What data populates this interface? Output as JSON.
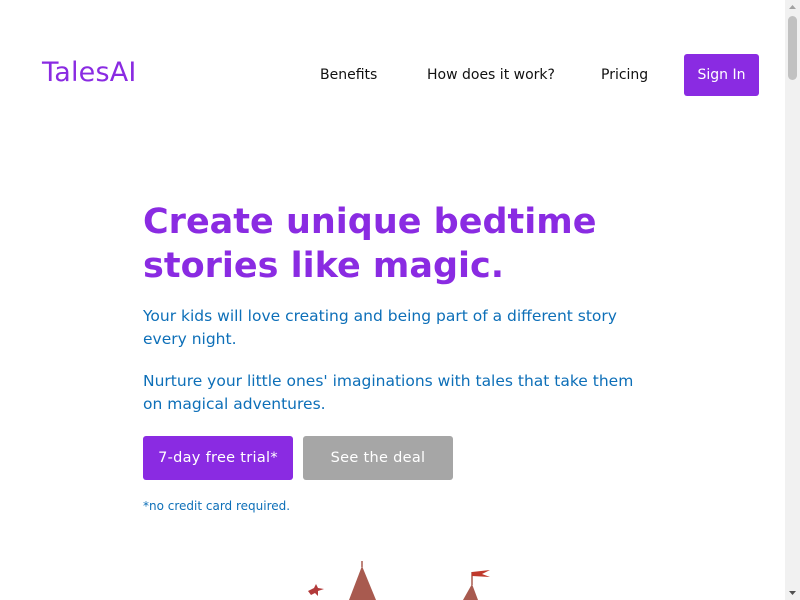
{
  "header": {
    "logo": "TalesAI",
    "nav": [
      {
        "label": "Benefits"
      },
      {
        "label": "How does it work?"
      },
      {
        "label": "Pricing"
      }
    ],
    "signin_label": "Sign In"
  },
  "hero": {
    "title": "Create unique bedtime stories like magic.",
    "paragraph1": "Your kids will love creating and being part of a different story every night.",
    "paragraph2": "Nurture your little ones' imaginations with tales that take them on magical adventures.",
    "trial_button": "7-day free trial*",
    "deal_button": "See the deal",
    "note": "*no credit card required."
  },
  "colors": {
    "brand": "#8a2be2",
    "text_blue": "#0d6fb8",
    "secondary_button": "#a6a6a6"
  },
  "icons": {
    "castle": "castle-illustration",
    "scroll_up": "arrow-up-icon",
    "scroll_down": "arrow-down-icon"
  }
}
